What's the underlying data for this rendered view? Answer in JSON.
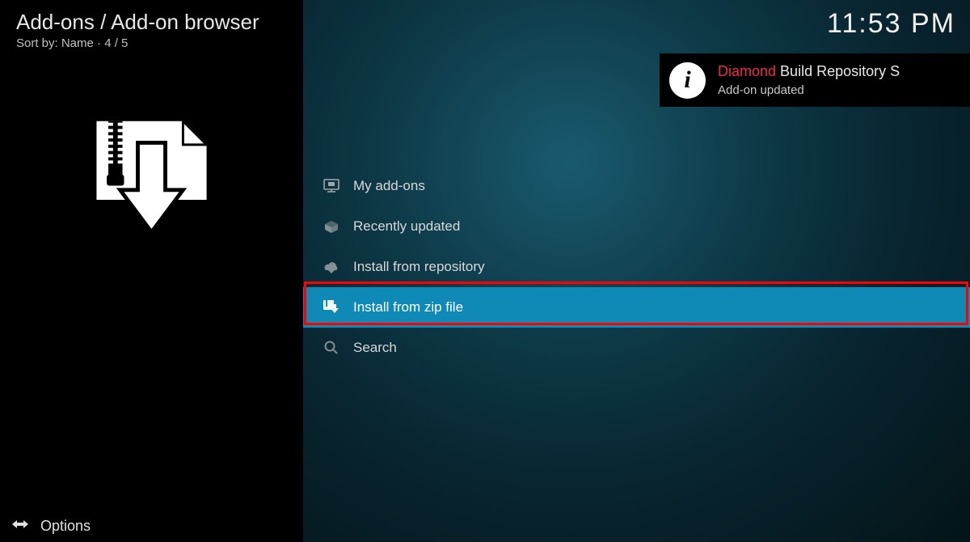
{
  "breadcrumb": "Add-ons / Add-on browser",
  "sort": {
    "label": "Sort by: Name",
    "position": " · 4 / 5"
  },
  "clock": "11:53 PM",
  "menu": [
    {
      "label": "My add-ons",
      "icon": "monitor-icon",
      "selected": false
    },
    {
      "label": "Recently updated",
      "icon": "box-open-icon",
      "selected": false
    },
    {
      "label": "Install from repository",
      "icon": "cloud-download-icon",
      "selected": false
    },
    {
      "label": "Install from zip file",
      "icon": "zip-download-icon",
      "selected": true
    },
    {
      "label": "Search",
      "icon": "search-icon",
      "selected": false
    }
  ],
  "notification": {
    "highlight": "Diamond",
    "rest": " Build Repository S",
    "subtitle": "Add-on updated"
  },
  "options_label": "Options"
}
